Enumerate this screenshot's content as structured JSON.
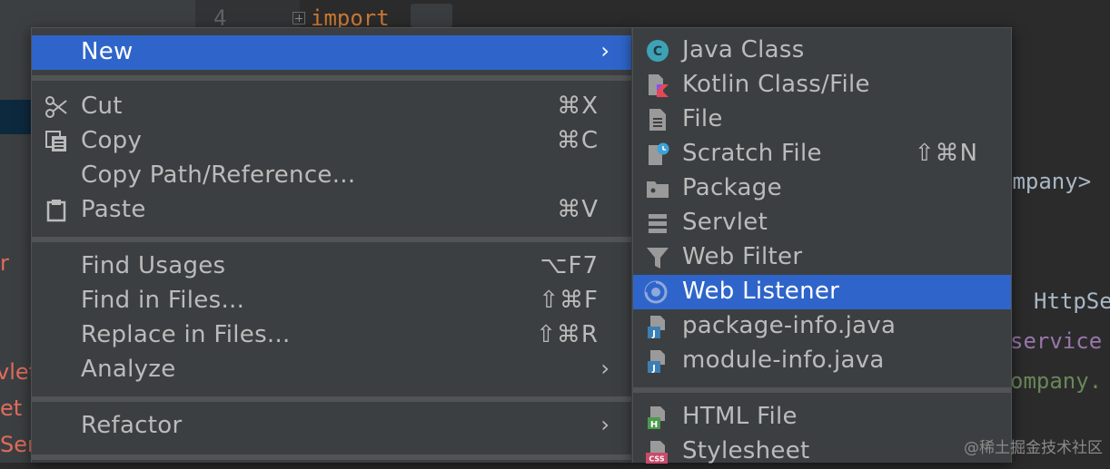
{
  "editor": {
    "line_number": "4",
    "code_line": "import",
    "fragments": {
      "company_tag": "ompany>",
      "http": "HttpSe",
      "service": "service",
      "company_dot": "ompany."
    },
    "left_fragments": [
      "r",
      "vlet",
      "et",
      "Ser"
    ]
  },
  "main_menu": {
    "new": {
      "label": "New",
      "arrow": "›"
    },
    "cut": {
      "label": "Cut",
      "shortcut": "⌘X"
    },
    "copy": {
      "label": "Copy",
      "shortcut": "⌘C"
    },
    "copy_path": {
      "label": "Copy Path/Reference..."
    },
    "paste": {
      "label": "Paste",
      "shortcut": "⌘V"
    },
    "find_usages": {
      "label": "Find Usages",
      "shortcut": "⌥F7"
    },
    "find_in_files": {
      "label": "Find in Files...",
      "shortcut": "⇧⌘F"
    },
    "replace_in_files": {
      "label": "Replace in Files...",
      "shortcut": "⇧⌘R"
    },
    "analyze": {
      "label": "Analyze",
      "arrow": "›"
    },
    "refactor": {
      "label": "Refactor",
      "arrow": "›"
    }
  },
  "sub_menu": {
    "java_class": {
      "label": "Java Class",
      "icon_letter": "C"
    },
    "kotlin_class": {
      "label": "Kotlin Class/File"
    },
    "file": {
      "label": "File"
    },
    "scratch_file": {
      "label": "Scratch File",
      "shortcut": "⇧⌘N"
    },
    "package": {
      "label": "Package"
    },
    "servlet": {
      "label": "Servlet"
    },
    "web_filter": {
      "label": "Web Filter"
    },
    "web_listener": {
      "label": "Web Listener"
    },
    "package_info": {
      "label": "package-info.java",
      "icon_letter": "J"
    },
    "module_info": {
      "label": "module-info.java",
      "icon_letter": "J"
    },
    "html_file": {
      "label": "HTML File",
      "icon_letter": "H"
    },
    "stylesheet": {
      "label": "Stylesheet",
      "icon_letter": "CSS"
    }
  },
  "watermark": "@稀土掘金技术社区",
  "colors": {
    "highlight": "#2f65ca",
    "menu_bg": "#3c3f41",
    "text": "#bbbbbb"
  }
}
